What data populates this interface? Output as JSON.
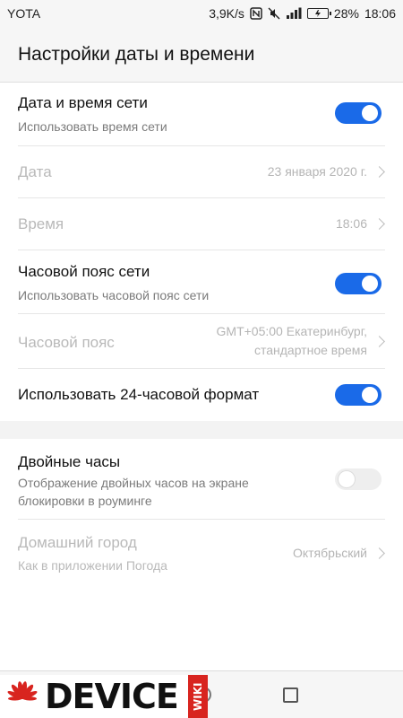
{
  "status_bar": {
    "carrier": "YOTA",
    "net_speed": "3,9K/s",
    "nfc_icon": "nfc-icon",
    "mute_icon": "vibrate-mute-icon",
    "signal_label": "4G",
    "battery_percent": "28%",
    "time": "18:06"
  },
  "app_bar": {
    "title": "Настройки даты и времени"
  },
  "settings": {
    "network_time": {
      "label": "Дата и время сети",
      "summary": "Использовать время сети",
      "enabled": true
    },
    "date": {
      "label": "Дата",
      "value": "23 января 2020 г."
    },
    "time": {
      "label": "Время",
      "value": "18:06"
    },
    "network_timezone": {
      "label": "Часовой пояс сети",
      "summary": "Использовать часовой пояс сети",
      "enabled": true
    },
    "timezone": {
      "label": "Часовой пояс",
      "value_line1": "GMT+05:00 Екатеринбург,",
      "value_line2": "стандартное время"
    },
    "format_24h": {
      "label": "Использовать 24-часовой формат",
      "enabled": true
    },
    "dual_clock": {
      "label": "Двойные часы",
      "summary_line1": "Отображение двойных часов на экране",
      "summary_line2": "блокировки в роуминге",
      "enabled": false
    },
    "home_city": {
      "label": "Домашний город",
      "summary": "Как в приложении Погода",
      "value": "Октябрьский"
    }
  },
  "watermark": {
    "text": "DEVICE",
    "badge": "WIKI"
  },
  "colors": {
    "accent": "#1a6ae8",
    "disabled_text": "#b9b9b9",
    "background": "#f3f3f3"
  }
}
